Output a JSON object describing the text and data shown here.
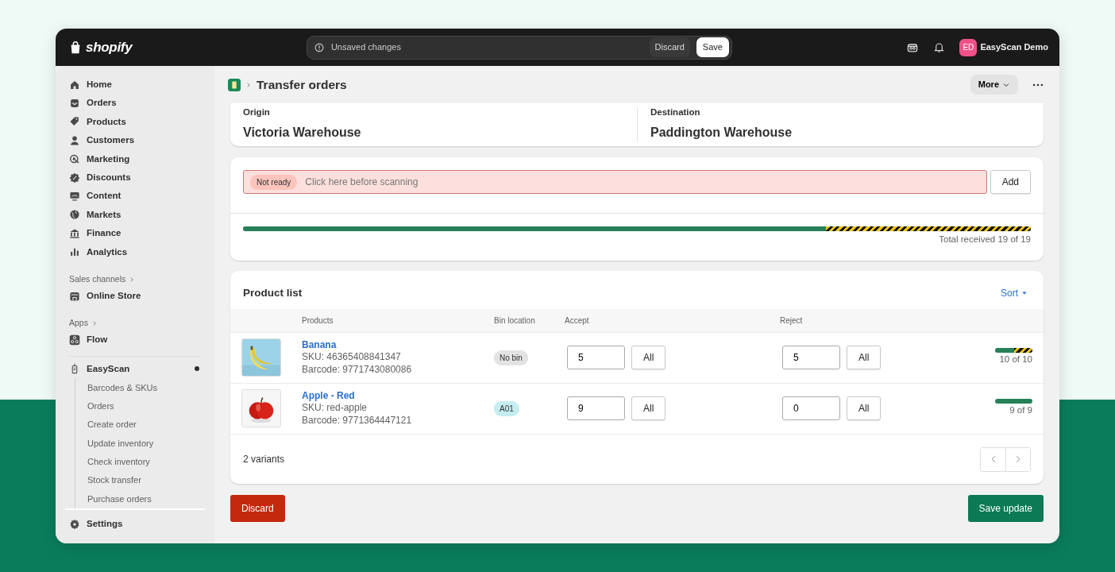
{
  "topbar": {
    "logo": "shopify",
    "notice": "Unsaved changes",
    "discard": "Discard",
    "save": "Save",
    "user": {
      "initials": "ED",
      "name": "EasyScan Demo"
    }
  },
  "sidebar": {
    "items": [
      {
        "label": "Home"
      },
      {
        "label": "Orders"
      },
      {
        "label": "Products"
      },
      {
        "label": "Customers"
      },
      {
        "label": "Marketing"
      },
      {
        "label": "Discounts"
      },
      {
        "label": "Content"
      },
      {
        "label": "Markets"
      },
      {
        "label": "Finance"
      },
      {
        "label": "Analytics"
      }
    ],
    "sales_channels": {
      "heading": "Sales channels",
      "items": [
        {
          "label": "Online Store"
        }
      ]
    },
    "apps": {
      "heading": "Apps",
      "items": [
        {
          "label": "Flow"
        }
      ]
    },
    "app": {
      "label": "EasyScan",
      "children": [
        {
          "label": "Barcodes & SKUs"
        },
        {
          "label": "Orders"
        },
        {
          "label": "Create order"
        },
        {
          "label": "Update inventory"
        },
        {
          "label": "Check inventory"
        },
        {
          "label": "Stock transfer"
        },
        {
          "label": "Purchase orders"
        }
      ]
    },
    "settings": "Settings"
  },
  "header": {
    "title": "Transfer orders",
    "more": "More"
  },
  "locations": [
    {
      "label": "Origin",
      "value": "Victoria Warehouse"
    },
    {
      "label": "Destination",
      "value": "Paddington Warehouse"
    }
  ],
  "scan": {
    "status": "Not ready",
    "placeholder": "Click here before scanning",
    "button": "Add"
  },
  "progress": {
    "segments": [
      {
        "kind": "accepted",
        "level": 0.74
      },
      {
        "kind": "rejected",
        "level": 0.26
      }
    ],
    "reading": "Total received 19 of 19"
  },
  "product_list": {
    "title": "Product list",
    "sort": "Sort",
    "columns": [
      "Products",
      "Bin location",
      "Accept",
      "Reject"
    ],
    "rows": [
      {
        "thumb": {
          "kind": "picture"
        },
        "name": "Banana",
        "sku": "SKU: 46365408841347",
        "barcode": "Barcode: 9771743080086",
        "bin": {
          "label": "No bin",
          "color": "#e3e3e3"
        },
        "accept": "5",
        "accept_all": "All",
        "reject": "5",
        "reject_all": "All",
        "segments": [
          {
            "kind": "accepted",
            "level": 0.5
          },
          {
            "kind": "rejected",
            "level": 0.5
          }
        ],
        "reading": "10 of 10"
      },
      {
        "thumb": {
          "kind": "picture"
        },
        "name": "Apple - Red",
        "sku": "SKU: red-apple",
        "barcode": "Barcode: 9771364447121",
        "bin": {
          "label": "A01",
          "color": "#c6eef2"
        },
        "accept": "9",
        "accept_all": "All",
        "reject": "0",
        "reject_all": "All",
        "segments": [
          {
            "kind": "accepted",
            "level": 1
          }
        ],
        "reading": "9 of 9"
      }
    ],
    "footer": "2 variants"
  },
  "actions": {
    "discard": "Discard",
    "save": "Save update"
  }
}
